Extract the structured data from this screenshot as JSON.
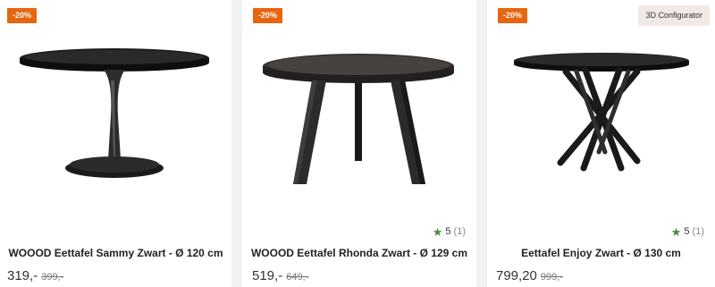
{
  "products": [
    {
      "badge": "-20%",
      "title": "WOOOD Eettafel Sammy Zwart - Ø 120 cm",
      "price": "319,-",
      "old_price": "399,-",
      "image_icon": "round-pedestal-table-image"
    },
    {
      "badge": "-20%",
      "title": "WOOOD Eettafel Rhonda Zwart - Ø 129 cm",
      "price": "519,-",
      "old_price": "649,-",
      "rating": "5",
      "rating_count": "(1)",
      "image_icon": "round-three-leg-table-image"
    },
    {
      "badge": "-20%",
      "configurator": "3D Configurator",
      "title": "Eettafel Enjoy Zwart - Ø 130 cm",
      "price": "799,20",
      "old_price": "999,-",
      "rating": "5",
      "rating_count": "(1)",
      "image_icon": "round-cross-leg-table-image"
    }
  ],
  "colors": {
    "badge_bg": "#e8650f",
    "star": "#4a8c3a",
    "configurator_bg": "#f1e9e4"
  }
}
